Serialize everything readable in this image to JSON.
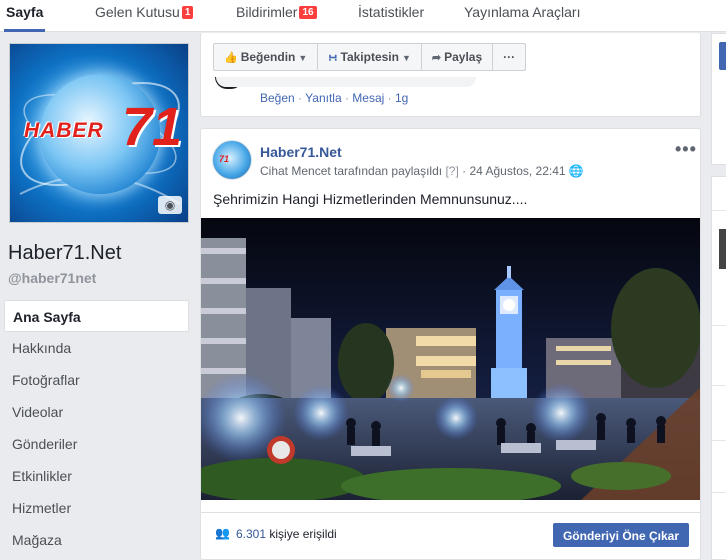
{
  "colors": {
    "accent": "#4267b2",
    "badge": "#fa3e3e",
    "link": "#365899",
    "background": "#e9ebee"
  },
  "tabs": [
    {
      "label": "Sayfa",
      "active": true
    },
    {
      "label": "Gelen Kutusu",
      "badge": "1"
    },
    {
      "label": "Bildirimler",
      "badge": "16"
    },
    {
      "label": "İstatistikler"
    },
    {
      "label": "Yayınlama Araçları"
    }
  ],
  "page": {
    "logo_text": "HABER",
    "logo_number": "71",
    "name": "Haber71.Net",
    "handle": "@haber71net",
    "avatar_icon": "camera-icon"
  },
  "nav": {
    "items": [
      {
        "label": "Ana Sayfa",
        "active": true
      },
      {
        "label": "Hakkında"
      },
      {
        "label": "Fotoğraflar"
      },
      {
        "label": "Videolar"
      },
      {
        "label": "Gönderiler"
      },
      {
        "label": "Etkinlikler"
      },
      {
        "label": "Hizmetler"
      },
      {
        "label": "Mağaza"
      }
    ]
  },
  "actions": {
    "like": "Beğendin",
    "follow": "Takiptesin",
    "share": "Paylaş",
    "more": "···"
  },
  "comment_actions": {
    "like": "Beğen",
    "reply": "Yanıtla",
    "message": "Mesaj",
    "time": "1g",
    "separator": " · "
  },
  "post": {
    "author": "Haber71.Net",
    "avatar_logo": "71",
    "meta": "Cihat Mencet tarafından paylaşıldı",
    "help": "[?]",
    "date": "24 Ağustos, 22:41",
    "privacy_icon": "globe-icon",
    "more": "•••",
    "text": "Şehrimizin Hangi Hizmetlerinden Memnunsunuz....",
    "reach_count": "6.301",
    "reach_label": "kişiye erişildi",
    "boost_label": "Gönderiyi Öne Çıkar"
  }
}
